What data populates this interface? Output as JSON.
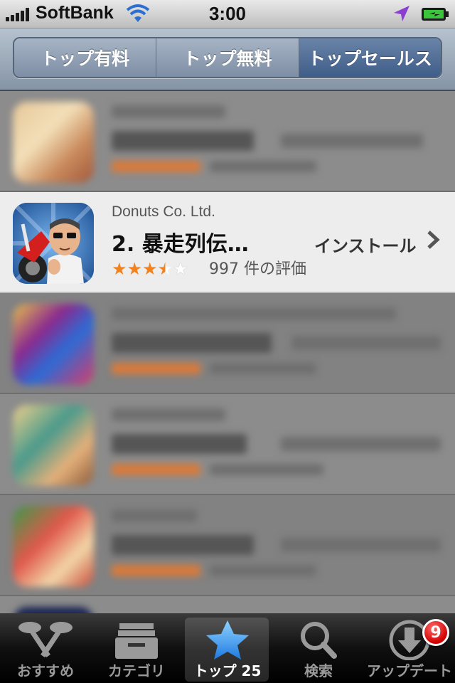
{
  "status_bar": {
    "carrier": "SoftBank",
    "time": "3:00"
  },
  "segmented": {
    "items": [
      {
        "label": "トップ有料"
      },
      {
        "label": "トップ無料"
      },
      {
        "label": "トップセールス"
      }
    ],
    "selected": "トップセールス"
  },
  "list": {
    "featured": {
      "developer": "Donuts Co. Ltd.",
      "title": "2. 暴走列伝…",
      "rating": 3.5,
      "reviews": "997 件の評価",
      "action": "インストール"
    }
  },
  "tab_bar": {
    "items": [
      {
        "label": "おすすめ",
        "icon": "featured-icon"
      },
      {
        "label": "カテゴリ",
        "icon": "categories-icon"
      },
      {
        "label": "トップ 25",
        "icon": "star-icon"
      },
      {
        "label": "検索",
        "icon": "search-icon"
      },
      {
        "label": "アップデート",
        "icon": "download-icon",
        "badge": "9"
      }
    ],
    "selected": "トップ 25"
  },
  "colors": {
    "accent_star": "#f2821e",
    "segment_active": "#3f5d89",
    "badge": "#d10000"
  }
}
